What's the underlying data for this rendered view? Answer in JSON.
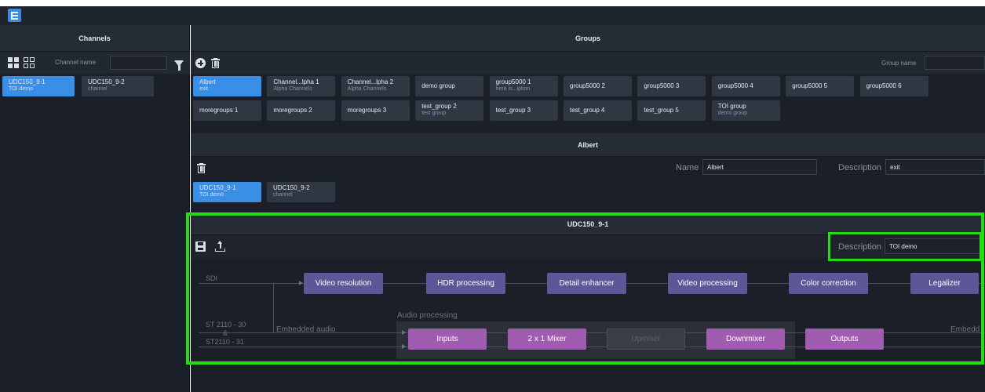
{
  "app": {
    "logo_icon": "list-layout-icon"
  },
  "channels": {
    "title": "Channels",
    "filter_label": "Channel name",
    "filter_value": "",
    "items": [
      {
        "name": "UDC150_9-1",
        "sub": "TOI demo",
        "selected": true
      },
      {
        "name": "UDC150_9-2",
        "sub": "channel",
        "selected": false
      }
    ]
  },
  "groups": {
    "title": "Groups",
    "filter_label": "Group name",
    "filter_value": "",
    "items": [
      {
        "name": "Albert",
        "sub": "exit",
        "selected": true
      },
      {
        "name": "Channel...lpha 1",
        "sub": "Alpha Channels"
      },
      {
        "name": "Channel...lpha 2",
        "sub": "Alpha Channels"
      },
      {
        "name": "demo group",
        "sub": ""
      },
      {
        "name": "group5000 1",
        "sub": "here is...iption"
      },
      {
        "name": "group5000 2",
        "sub": ""
      },
      {
        "name": "group5000 3",
        "sub": ""
      },
      {
        "name": "group5000 4",
        "sub": ""
      },
      {
        "name": "group5000 5",
        "sub": ""
      },
      {
        "name": "group5000 6",
        "sub": ""
      },
      {
        "name": "moregroups 1",
        "sub": ""
      },
      {
        "name": "moregroups 2",
        "sub": ""
      },
      {
        "name": "moregroups 3",
        "sub": ""
      },
      {
        "name": "test_group 2",
        "sub": "test group"
      },
      {
        "name": "test_group 3",
        "sub": ""
      },
      {
        "name": "test_group 4",
        "sub": ""
      },
      {
        "name": "test_group 5",
        "sub": ""
      },
      {
        "name": "TOI group",
        "sub": "demo group"
      }
    ]
  },
  "group_detail": {
    "title": "Albert",
    "name_label": "Name",
    "name_value": "Albert",
    "description_label": "Description",
    "description_value": "exit",
    "members": [
      {
        "name": "UDC150_9-1",
        "sub": "TOI demo",
        "selected": true
      },
      {
        "name": "UDC150_9-2",
        "sub": "channel",
        "selected": false
      }
    ]
  },
  "channel_detail": {
    "title": "UDC150_9-1",
    "description_label": "Description",
    "description_value": "TOI demo",
    "pipeline": {
      "input_sdi": "SDI",
      "input_st2110_l1": "ST 2110 - 30",
      "input_st2110_l2": "&",
      "input_st2110_l3": "ST2110 - 31",
      "embedded_audio": "Embedded audio",
      "audio_processing": "Audio processing",
      "embedded_out": "Embedd",
      "video_nodes": [
        "Video resolution",
        "HDR processing",
        "Detail enhancer",
        "Video processing",
        "Color correction",
        "Legalizer"
      ],
      "audio_nodes": [
        {
          "label": "Inputs",
          "enabled": true
        },
        {
          "label": "2 x 1 Mixer",
          "enabled": true
        },
        {
          "label": "Upmixer",
          "enabled": false
        },
        {
          "label": "Downmixer",
          "enabled": true
        },
        {
          "label": "Outputs",
          "enabled": true
        }
      ]
    }
  },
  "colors": {
    "accent": "#3a8ee6",
    "highlight": "#22dd11",
    "video_node": "#5c5898",
    "audio_node": "#a05cb0"
  }
}
